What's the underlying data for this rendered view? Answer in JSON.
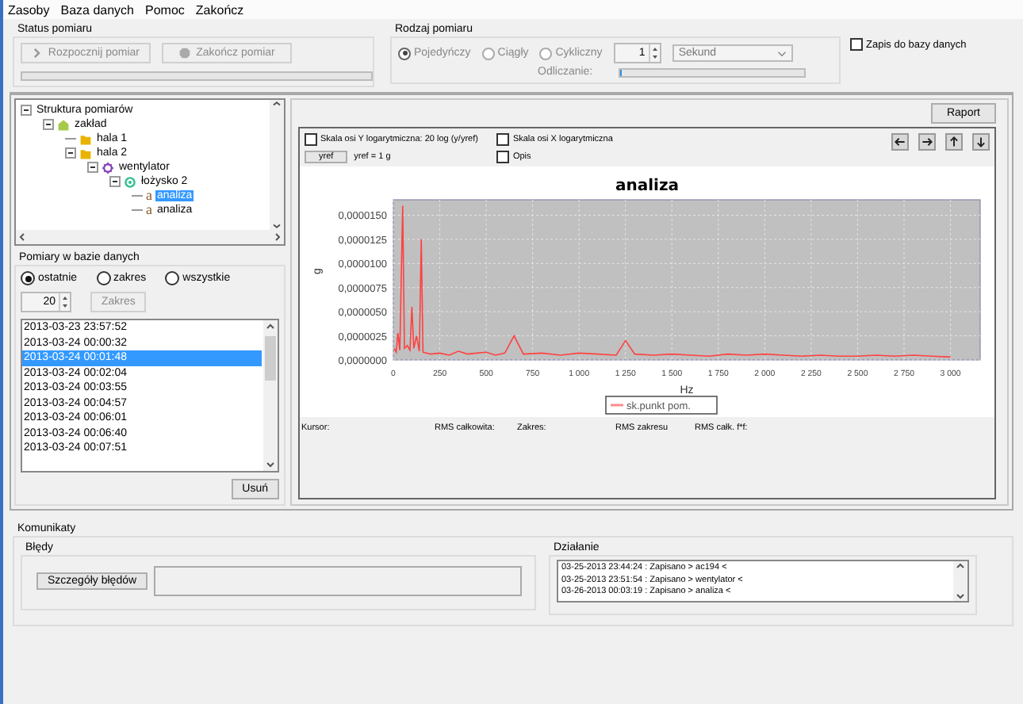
{
  "menu": [
    "Zasoby",
    "Baza danych",
    "Pomoc",
    "Zakończ"
  ],
  "status_group": {
    "title": "Status pomiaru",
    "buttons": [
      {
        "label": "Rozpocznij pomiar",
        "kind": "start",
        "disabled": true
      },
      {
        "label": "Zakończ pomiar",
        "kind": "stop",
        "disabled": true
      }
    ],
    "progress": {
      "level": 0
    }
  },
  "measure_type": {
    "title": "Rodzaj pomiaru",
    "options": [
      {
        "label": "Pojedyńczy",
        "selected": true
      },
      {
        "label": "Ciągły",
        "selected": false
      },
      {
        "label": "Cykliczny",
        "selected": false
      }
    ],
    "interval": "1",
    "unit": "Sekund",
    "countdown_label": "Odliczanie:",
    "countdown": {
      "level": 0.01
    }
  },
  "save_to_db": {
    "label": "Zapis do bazy danych",
    "checked": false
  },
  "tree": {
    "title": "Struktura pomiarów",
    "expanded": true,
    "children": [
      {
        "label": "zakład",
        "kind": "site",
        "expanded": true,
        "selected": false,
        "children": [
          {
            "label": "hala 1",
            "kind": "hall",
            "selected": false
          },
          {
            "label": "hala 2",
            "kind": "hall",
            "expanded": true,
            "selected": false,
            "children": [
              {
                "label": "wentylator",
                "kind": "machine",
                "expanded": true,
                "selected": false,
                "children": [
                  {
                    "label": "łożysko 2",
                    "kind": "bearing",
                    "expanded": true,
                    "selected": false,
                    "children": [
                      {
                        "label": "analiza",
                        "kind": "analysis",
                        "glyph": "a",
                        "selected": true
                      },
                      {
                        "label": "analiza",
                        "kind": "analysis",
                        "glyph": "a",
                        "selected": false
                      }
                    ]
                  }
                ]
              }
            ]
          }
        ]
      }
    ]
  },
  "db_measurements": {
    "title": "Pomiary w bazie danych",
    "filters": [
      {
        "label": "ostatnie",
        "selected": true
      },
      {
        "label": "zakres",
        "selected": false
      },
      {
        "label": "wszystkie",
        "selected": false
      }
    ],
    "count": "20",
    "range_button": "Zakres",
    "items": [
      {
        "label": "2013-03-23 23:57:52",
        "selected": false
      },
      {
        "label": "2013-03-24 00:00:32",
        "selected": false
      },
      {
        "label": "2013-03-24 00:01:48",
        "selected": true
      },
      {
        "label": "2013-03-24 00:02:04",
        "selected": false
      },
      {
        "label": "2013-03-24 00:03:55",
        "selected": false
      },
      {
        "label": "2013-03-24 00:04:57",
        "selected": false
      },
      {
        "label": "2013-03-24 00:06:01",
        "selected": false
      },
      {
        "label": "2013-03-24 00:06:40",
        "selected": false
      },
      {
        "label": "2013-03-24 00:07:51",
        "selected": false
      }
    ],
    "delete_button": "Usuń"
  },
  "report_button": "Raport",
  "chart_options": {
    "y_log": {
      "label": "Skala osi Y logarytmiczna: 20 log (y/yref)",
      "checked": false
    },
    "x_log": {
      "label": "Skala osi X logarytmiczna",
      "checked": false
    },
    "yref_button": "yref",
    "yref_value": "yref = 1 g",
    "description": {
      "label": "Opis",
      "checked": false
    }
  },
  "chart": {
    "chart_data": {
      "type": "line",
      "grid": true,
      "title": "analiza",
      "xlabel": "Hz",
      "ylabel": "g",
      "xlim": [
        0,
        3160
      ],
      "ylim": [
        0,
        1.66e-05
      ],
      "xticks": [
        {
          "value": 0,
          "label": "0"
        },
        {
          "value": 250,
          "label": "250"
        },
        {
          "value": 500,
          "label": "500"
        },
        {
          "value": 750,
          "label": "750"
        },
        {
          "value": 1000,
          "label": "1 000"
        },
        {
          "value": 1250,
          "label": "1 250"
        },
        {
          "value": 1500,
          "label": "1 500"
        },
        {
          "value": 1750,
          "label": "1 750"
        },
        {
          "value": 2000,
          "label": "2 000"
        },
        {
          "value": 2250,
          "label": "2 250"
        },
        {
          "value": 2500,
          "label": "2 500"
        },
        {
          "value": 2750,
          "label": "2 750"
        },
        {
          "value": 3000,
          "label": "3 000"
        }
      ],
      "yticks": [
        {
          "value": 0,
          "label": "0,0000000"
        },
        {
          "value": 2.5e-06,
          "label": "0,0000025"
        },
        {
          "value": 5e-06,
          "label": "0,0000050"
        },
        {
          "value": 7.5e-06,
          "label": "0,0000075"
        },
        {
          "value": 1e-05,
          "label": "0,0000100"
        },
        {
          "value": 1.25e-05,
          "label": "0,0000125"
        },
        {
          "value": 1.5e-05,
          "label": "0,0000150"
        }
      ],
      "x": [
        5,
        15,
        25,
        35,
        50,
        60,
        75,
        90,
        100,
        110,
        125,
        140,
        150,
        160,
        200,
        250,
        300,
        350,
        400,
        450,
        500,
        550,
        600,
        650,
        700,
        800,
        900,
        1000,
        1100,
        1200,
        1250,
        1300,
        1400,
        1500,
        1600,
        1700,
        1800,
        1900,
        2000,
        2100,
        2200,
        2300,
        2400,
        2500,
        2600,
        2700,
        2800,
        2900,
        3000
      ],
      "series": [
        {
          "name": "sk.punkt pom.",
          "color": "#ff4040",
          "values": [
            1.2e-06,
            8e-07,
            2.8e-06,
            1e-06,
            1.6e-05,
            1.2e-06,
            1.5e-06,
            1e-06,
            5.5e-06,
            1.2e-06,
            2.5e-06,
            9e-07,
            1.25e-05,
            8e-07,
            6e-07,
            7e-07,
            5e-07,
            9e-07,
            6e-07,
            7e-07,
            8e-07,
            5e-07,
            7e-07,
            2.5e-06,
            6e-07,
            7e-07,
            5e-07,
            7e-07,
            6e-07,
            5e-07,
            2e-06,
            6e-07,
            5e-07,
            6e-07,
            5e-07,
            4e-07,
            6e-07,
            5e-07,
            6e-07,
            5e-07,
            4e-07,
            5e-07,
            4e-07,
            4e-07,
            5e-07,
            4e-07,
            5e-07,
            4e-07,
            3e-07
          ]
        }
      ]
    }
  },
  "readouts": [
    "Kursor:",
    "RMS całkowita:",
    "Zakres:",
    "RMS zakresu",
    "RMS całk. f*f:"
  ],
  "messages": {
    "title": "Komunikaty",
    "errors": {
      "title": "Błędy",
      "button": "Szczegóły błędów"
    },
    "actions": {
      "title": "Działanie",
      "lines": [
        "03-25-2013 23:44:24 : Zapisano > ac194 <",
        "03-25-2013 23:51:54 : Zapisano > wentylator <",
        "03-26-2013 00:03:19 : Zapisano > analiza <"
      ]
    }
  }
}
